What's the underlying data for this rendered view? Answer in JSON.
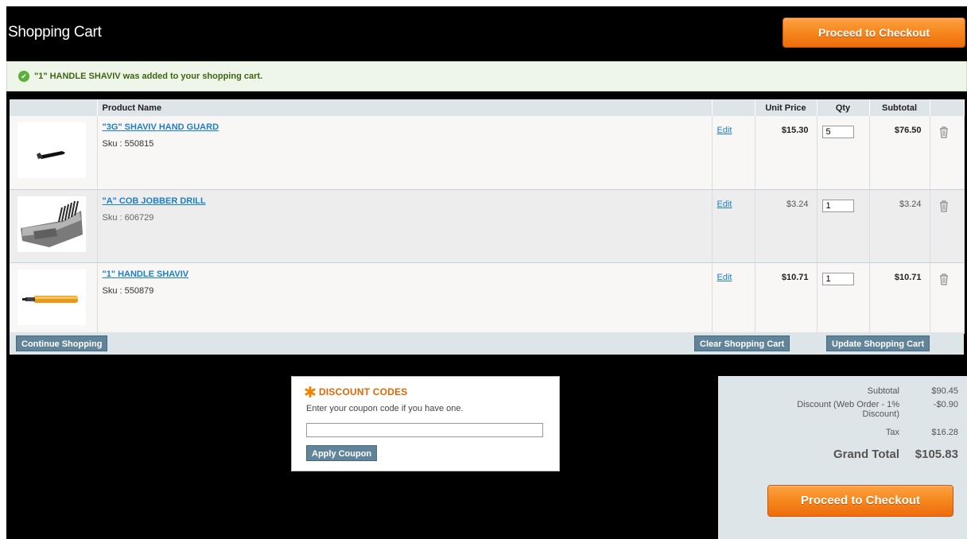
{
  "page": {
    "title": "Shopping Cart"
  },
  "header": {
    "checkout_label": "Proceed to Checkout"
  },
  "message": {
    "text": "\"1\" HANDLE SHAVIV was added to your shopping cart.",
    "icon": "check-circle-icon"
  },
  "cart": {
    "columns": {
      "product": "Product Name",
      "unit_price": "Unit Price",
      "qty": "Qty",
      "subtotal": "Subtotal"
    },
    "items": [
      {
        "name": "\"3G\" SHAVIV HAND GUARD",
        "sku": "Sku : 550815",
        "edit": "Edit",
        "unit_price": "$15.30",
        "qty": "5",
        "subtotal": "$76.50",
        "image": "hand-guard-image"
      },
      {
        "name": "\"A\" COB JOBBER DRILL",
        "sku": "Sku : 606729",
        "edit": "Edit",
        "unit_price": "$3.24",
        "qty": "1",
        "subtotal": "$3.24",
        "image": "drill-set-image"
      },
      {
        "name": "\"1\" HANDLE SHAVIV",
        "sku": "Sku : 550879",
        "edit": "Edit",
        "unit_price": "$10.71",
        "qty": "1",
        "subtotal": "$10.71",
        "image": "handle-image"
      }
    ],
    "actions": {
      "continue": "Continue Shopping",
      "clear": "Clear Shopping Cart",
      "update": "Update Shopping Cart"
    }
  },
  "discount": {
    "title": "DISCOUNT CODES",
    "hint": "Enter your coupon code if you have one.",
    "input_value": "",
    "apply": "Apply Coupon"
  },
  "totals": {
    "subtotal_label": "Subtotal",
    "subtotal_value": "$90.45",
    "discount_label_line1": "Discount (Web Order - 1%",
    "discount_label_line2": "Discount)",
    "discount_value": "-$0.90",
    "tax_label": "Tax",
    "tax_value": "$16.28",
    "grand_total_label": "Grand Total",
    "grand_total_value": "$105.83",
    "checkout_label": "Proceed to Checkout"
  },
  "colors": {
    "accent_orange": "#f58a1f",
    "link_blue": "#1e7ec8",
    "success_green": "#3d6611",
    "button_gray_blue": "#618499"
  }
}
